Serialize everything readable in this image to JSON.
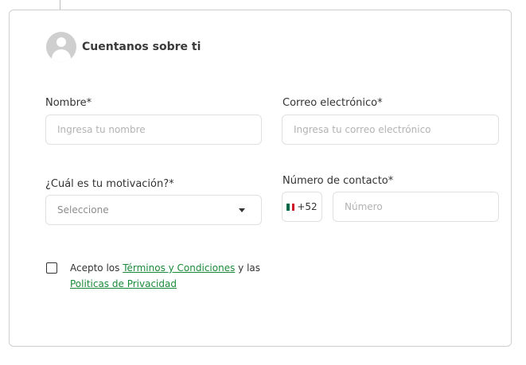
{
  "colors": {
    "accent": "#1a8a3a",
    "border": "#e0e0e0",
    "avatar": "#cfcfcf"
  },
  "header": {
    "title": "Cuentanos sobre ti",
    "icon": "user-avatar-icon"
  },
  "form": {
    "name": {
      "label": "Nombre*",
      "placeholder": "Ingresa tu nombre"
    },
    "email": {
      "label": "Correo electrónico*",
      "placeholder": "Ingresa tu correo electrónico"
    },
    "motivation": {
      "label": "¿Cuál es tu motivación?*",
      "selected": "Seleccione",
      "icon": "chevron-down-icon"
    },
    "phone": {
      "label": "Número de contacto*",
      "country_code": "+52",
      "country_flag": "mexico-flag-icon",
      "placeholder": "Número"
    }
  },
  "consent": {
    "text_before": "Acepto los ",
    "terms_link": "Términos y Condiciones",
    "text_middle": " y las ",
    "privacy_link": "Politicas de Privacidad"
  }
}
